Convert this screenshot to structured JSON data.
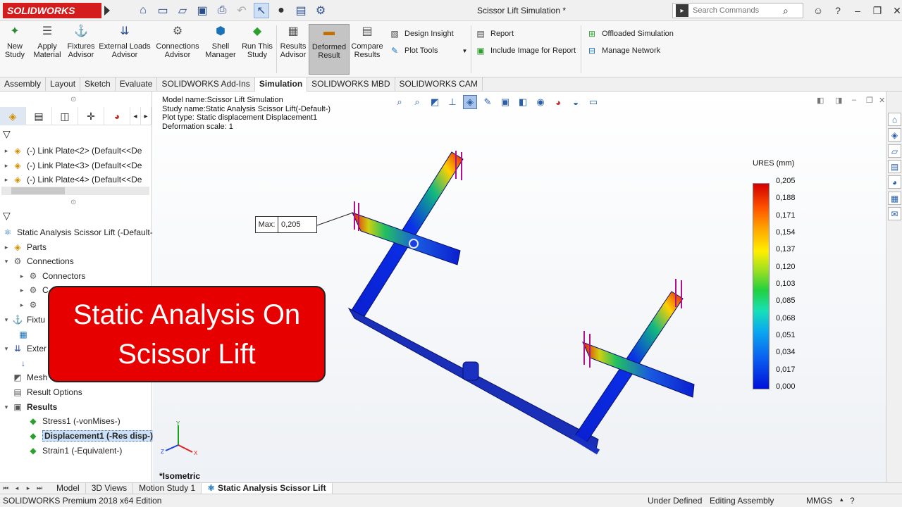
{
  "app": {
    "logo_text": "SOLIDWORKS",
    "window_title": "Scissor Lift Simulation *",
    "search_placeholder": "Search Commands"
  },
  "ribbon": {
    "buttons": [
      {
        "label": "New\nStudy",
        "icon": "new-study-icon"
      },
      {
        "label": "Apply\nMaterial",
        "icon": "apply-material-icon"
      },
      {
        "label": "Fixtures\nAdvisor",
        "icon": "fixtures-advisor-icon"
      },
      {
        "label": "External Loads\nAdvisor",
        "icon": "external-loads-icon"
      },
      {
        "label": "Connections\nAdvisor",
        "icon": "connections-advisor-icon"
      },
      {
        "label": "Shell\nManager",
        "icon": "shell-manager-icon"
      },
      {
        "label": "Run This\nStudy",
        "icon": "run-study-icon"
      },
      {
        "label": "Results\nAdvisor",
        "icon": "results-advisor-icon"
      },
      {
        "label": "Deformed\nResult",
        "icon": "deformed-result-icon"
      },
      {
        "label": "Compare\nResults",
        "icon": "compare-results-icon"
      }
    ],
    "design_insight": "Design Insight",
    "plot_tools": "Plot Tools",
    "report": "Report",
    "include_image": "Include Image for Report",
    "offloaded_sim": "Offloaded Simulation",
    "manage_network": "Manage Network"
  },
  "tabs": [
    "Assembly",
    "Layout",
    "Sketch",
    "Evaluate",
    "SOLIDWORKS Add-Ins",
    "Simulation",
    "SOLIDWORKS MBD",
    "SOLIDWORKS CAM"
  ],
  "active_tab": "Simulation",
  "tree_top": [
    "(-) Link Plate<2> (Default<<De",
    "(-) Link Plate<3> (Default<<De",
    "(-) Link Plate<4> (Default<<De"
  ],
  "study_tree": {
    "root": "Static Analysis Scissor Lift (-Default-)",
    "parts": "Parts",
    "connections": "Connections",
    "connectors": "Connectors",
    "contact_partial": "C",
    "fixtures_partial": "Fixtu",
    "external_partial": "Exter",
    "mesh": "Mesh",
    "result_options": "Result Options",
    "results": "Results",
    "stress": "Stress1 (-vonMises-)",
    "displacement": "Displacement1 (-Res disp-)",
    "strain": "Strain1 (-Equivalent-)"
  },
  "viewport": {
    "model_name": "Model name:Scissor Lift Simulation",
    "study_name": "Study name:Static Analysis Scissor Lift(-Default-)",
    "plot_type": "Plot type: Static displacement Displacement1",
    "deformation": "Deformation scale: 1",
    "max_key": "Max:",
    "max_value": "0,205",
    "view_label": "*Isometric",
    "legend_title": "URES (mm)",
    "legend_values": [
      "0,205",
      "0,188",
      "0,171",
      "0,154",
      "0,137",
      "0,120",
      "0,103",
      "0,085",
      "0,068",
      "0,051",
      "0,034",
      "0,017",
      "0,000"
    ]
  },
  "bottom_tabs": [
    "Model",
    "3D Views",
    "Motion Study 1",
    "Static Analysis Scissor Lift"
  ],
  "status": {
    "edition": "SOLIDWORKS Premium 2018 x64 Edition",
    "defined": "Under Defined",
    "editing": "Editing Assembly",
    "units": "MMGS"
  },
  "banner": {
    "line1": "Static Analysis On",
    "line2": "Scissor Lift"
  },
  "colors": {
    "brand_red": "#d41c1c",
    "banner_red": "#e60000",
    "beam_blue": "#1a2fb8"
  }
}
